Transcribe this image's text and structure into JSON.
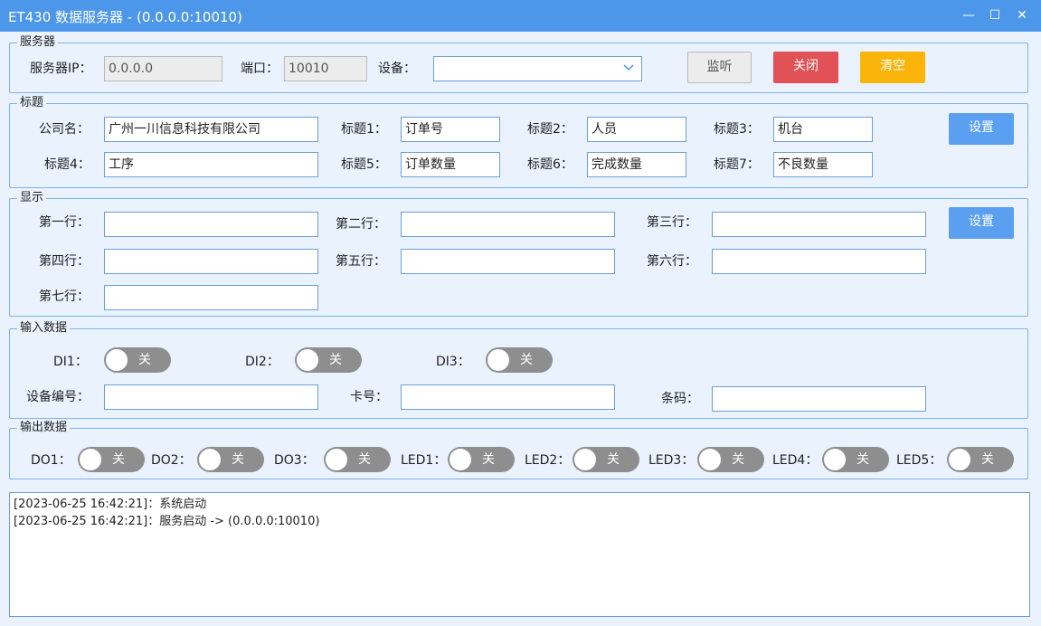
{
  "window": {
    "title": "ET430 数据服务器 - (0.0.0.0:10010)",
    "min": "—",
    "max": "☐",
    "close": "✕"
  },
  "server": {
    "legend": "服务器",
    "ip_label": "服务器IP：",
    "ip_value": "0.0.0.0",
    "port_label": "端口：",
    "port_value": "10010",
    "device_label": "设备：",
    "device_value": "",
    "listen_btn": "监听",
    "close_btn": "关闭",
    "clear_btn": "清空",
    "accent": {
      "close": "#e05256",
      "clear": "#fbb40a"
    }
  },
  "titles": {
    "legend": "标题",
    "company_label": "公司名：",
    "company_value": "广州一川信息科技有限公司",
    "t1_label": "标题1：",
    "t1_value": "订单号",
    "t2_label": "标题2：",
    "t2_value": "人员",
    "t3_label": "标题3：",
    "t3_value": "机台",
    "t4_label": "标题4：",
    "t4_value": "工序",
    "t5_label": "标题5：",
    "t5_value": "订单数量",
    "t6_label": "标题6：",
    "t6_value": "完成数量",
    "t7_label": "标题7：",
    "t7_value": "不良数量",
    "set_btn": "设置"
  },
  "display": {
    "legend": "显示",
    "r1_label": "第一行：",
    "r1_value": "",
    "r2_label": "第二行：",
    "r2_value": "",
    "r3_label": "第三行：",
    "r3_value": "",
    "r4_label": "第四行：",
    "r4_value": "",
    "r5_label": "第五行：",
    "r5_value": "",
    "r6_label": "第六行：",
    "r6_value": "",
    "r7_label": "第七行：",
    "r7_value": "",
    "set_btn": "设置"
  },
  "input": {
    "legend": "输入数据",
    "di1_label": "DI1：",
    "di2_label": "DI2：",
    "di3_label": "DI3：",
    "toggle_off": "关",
    "device_no_label": "设备编号：",
    "device_no_value": "",
    "card_label": "卡号：",
    "card_value": "",
    "barcode_label": "条码：",
    "barcode_value": ""
  },
  "output": {
    "legend": "输出数据",
    "do1_label": "DO1：",
    "do2_label": "DO2：",
    "do3_label": "DO3：",
    "led1_label": "LED1：",
    "led2_label": "LED2：",
    "led3_label": "LED3：",
    "led4_label": "LED4：",
    "led5_label": "LED5：",
    "toggle_off": "关"
  },
  "log": [
    "[2023-06-25 16:42:21]：系统启动",
    "[2023-06-25 16:42:21]：服务启动 -> (0.0.0.0:10010)"
  ]
}
